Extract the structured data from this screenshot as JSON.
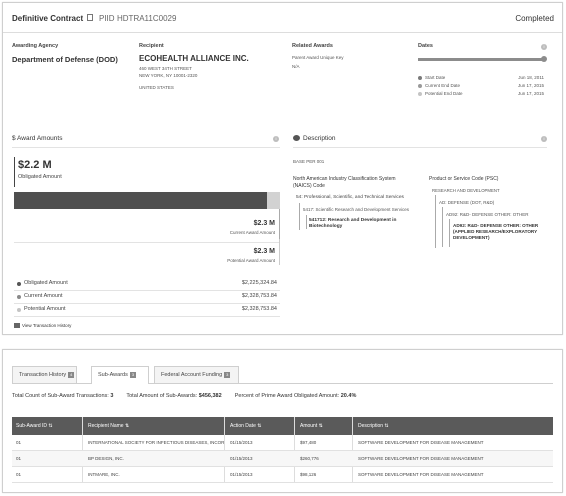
{
  "header": {
    "award_type": "Definitive Contract",
    "piid_label": "PIID",
    "piid": "HDTRA11C0029",
    "status": "Completed"
  },
  "overview": {
    "agency_label": "Awarding Agency",
    "agency": "Department of Defense (DOD)",
    "recipient_label": "Recipient",
    "recipient": "ECOHEALTH ALLIANCE INC.",
    "address_line1": "460 WEST 34TH STREET",
    "address_line2": "NEW YORK, NY 10001-2320",
    "address_line3": "UNITED STATES",
    "related_label": "Related Awards",
    "related_sub": "Parent Award Unique Key",
    "related_value": "N/A",
    "dates_label": "Dates",
    "dates": [
      {
        "label": "Start Date",
        "value": "Jun 18, 2011",
        "color": "#7a7a7a"
      },
      {
        "label": "Current End Date",
        "value": "Jun 17, 2015",
        "color": "#9a9a9a"
      },
      {
        "label": "Potential End Date",
        "value": "Jun 17, 2015",
        "color": "#c4c4c4"
      }
    ]
  },
  "award_amounts": {
    "title": "$ Award Amounts",
    "obligated_big": "$2.2 M",
    "obligated_big_label": "Obligated Amount",
    "current_big": "$2.3 M",
    "current_big_label": "Current Award Amount",
    "potential_big": "$2.3 M",
    "potential_big_label": "Potential Award Amount",
    "obligated_fraction": 0.9515,
    "rows": [
      {
        "label": "Obligated Amount",
        "value": "$2,225,324.84",
        "color": "#555555"
      },
      {
        "label": "Current Amount",
        "value": "$2,328,753.84",
        "color": "#8a8a8a"
      },
      {
        "label": "Potential Amount",
        "value": "$2,328,753.84",
        "color": "#c4c4c4"
      }
    ],
    "history_link": "View Transaction History"
  },
  "description": {
    "title": "Description",
    "text": "BASE PER 001",
    "naics_title": "North American Industry Classification System (NAICS) Code",
    "naics_l1": "54: Professional, Scientific, and Technical Services",
    "naics_l2": "5417: Scientific Research and Development Services",
    "naics_l3": "541712: Research and Development in Biotechnology",
    "psc_title": "Product or Service Code (PSC)",
    "psc_l1": "RESEARCH AND DEVELOPMENT",
    "psc_l2": "AD: DEFENSE (DOT, R&D)",
    "psc_l3": "AD92: R&D- DEFENSE OTHER: OTHER",
    "psc_l4": "AD92: R&D- DEFENSE OTHER: OTHER (APPLIED RESEARCH/EXPLORATORY DEVELOPMENT)"
  },
  "tabs": [
    {
      "label": "Transaction History",
      "count": "4"
    },
    {
      "label": "Sub-Awards",
      "count": "3"
    },
    {
      "label": "Federal Account Funding",
      "count": "3"
    }
  ],
  "subawards": {
    "count_label": "Total Count of Sub-Award Transactions:",
    "count_value": "3",
    "amount_label": "Total Amount of Sub-Awards:",
    "amount_value": "$456,382",
    "percent_label": "Percent of Prime Award Obligated Amount:",
    "percent_value": "20.4%",
    "columns": [
      "Sub-Award ID",
      "Recipient Name",
      "Action Date",
      "Amount",
      "Description"
    ],
    "rows": [
      [
        "01",
        "INTERNATIONAL SOCIETY FOR INFECTIOUS DISEASES, INCORPORATED",
        "01/15/2013",
        "$97,480",
        "SOFTWARE DEVELOPMENT FOR DISEASE MANAGEMENT"
      ],
      [
        "01",
        "BP DESIGN, INC.",
        "01/15/2013",
        "$260,776",
        "SOFTWARE DEVELOPMENT FOR DISEASE MANAGEMENT"
      ],
      [
        "01",
        "INTMARE, INC.",
        "01/15/2013",
        "$98,126",
        "SOFTWARE DEVELOPMENT FOR DISEASE MANAGEMENT"
      ]
    ]
  }
}
